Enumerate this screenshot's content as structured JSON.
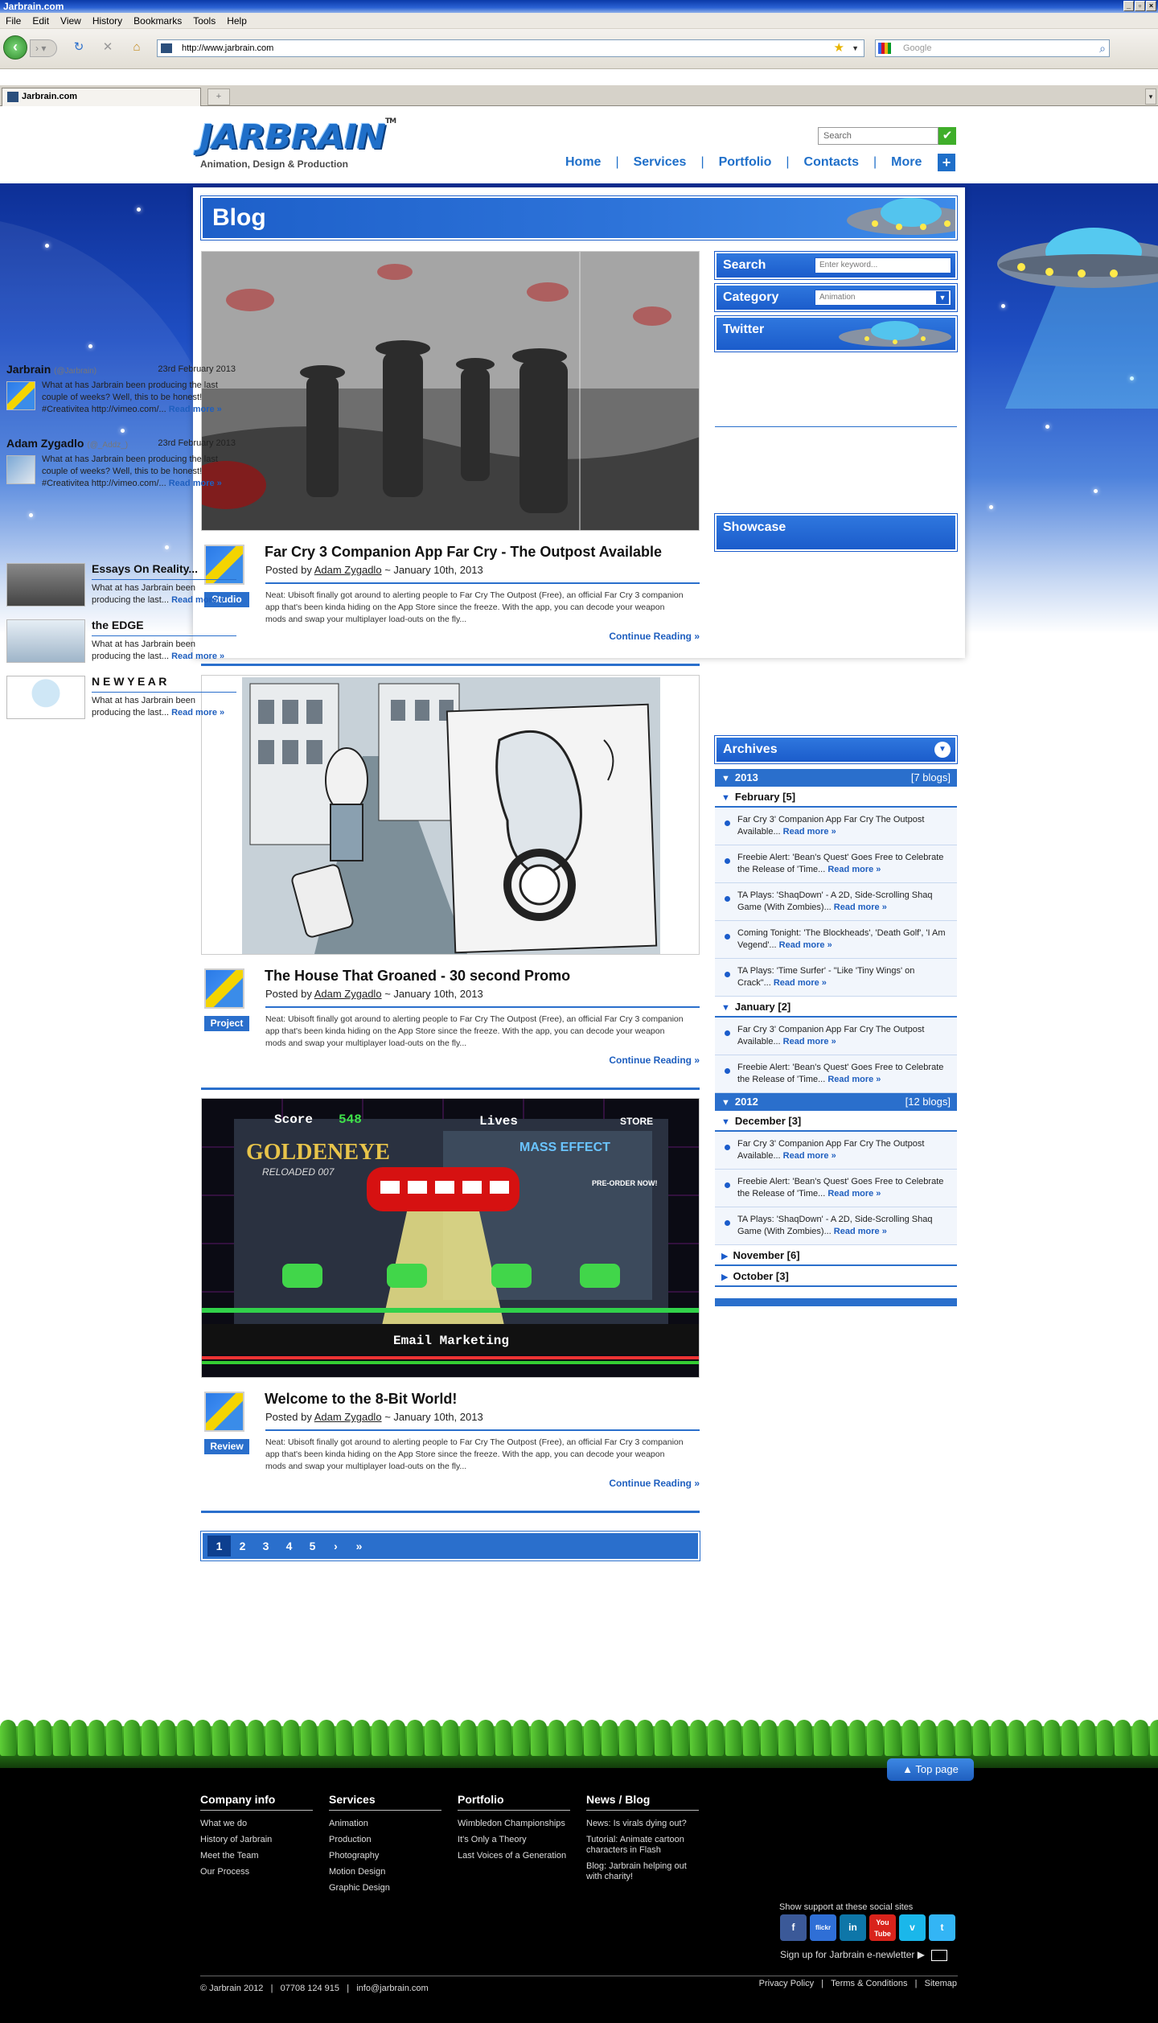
{
  "window": {
    "title": "Jarbrain.com"
  },
  "menu": [
    "File",
    "Edit",
    "View",
    "History",
    "Bookmarks",
    "Tools",
    "Help"
  ],
  "browser": {
    "url": "http://www.jarbrain.com",
    "search_placeholder": "Google",
    "tab_title": "Jarbrain.com"
  },
  "site": {
    "logo": "JARBRAIN",
    "tm": "TM",
    "tagline": "Animation, Design & Production",
    "search_placeholder": "Search",
    "nav": [
      "Home",
      "Services",
      "Portfolio",
      "Contacts",
      "More"
    ],
    "more_icon": "+",
    "page_title": "Blog"
  },
  "posts": [
    {
      "title": "Far Cry 3 Companion App Far Cry - The Outpost Available",
      "posted_by": "Posted by",
      "author": "Adam Zygadlo",
      "date": "~ January 10th, 2013",
      "tag": "Studio",
      "excerpt": "Neat: Ubisoft finally got around to alerting people to Far Cry The Outpost (Free), an official Far Cry 3 companion app that's been kinda hiding on the App Store since the freeze. With the app, you can decode your weapon mods and swap your multiplayer load-outs on the fly...",
      "continue": "Continue Reading »"
    },
    {
      "title": "The House That Groaned - 30 second Promo",
      "posted_by": "Posted by",
      "author": "Adam Zygadlo",
      "date": "~ January 10th, 2013",
      "tag": "Project",
      "excerpt": "Neat: Ubisoft finally got around to alerting people to Far Cry The Outpost (Free), an official Far Cry 3 companion app that's been kinda hiding on the App Store since the freeze. With the app, you can decode your weapon mods and swap your multiplayer load-outs on the fly...",
      "continue": "Continue Reading »"
    },
    {
      "title": "Welcome to the 8-Bit World!",
      "posted_by": "Posted by",
      "author": "Adam Zygadlo",
      "date": "~ January 10th, 2013",
      "tag": "Review",
      "excerpt": "Neat: Ubisoft finally got around to alerting people to Far Cry The Outpost (Free), an official Far Cry 3 companion app that's been kinda hiding on the App Store since the freeze. With the app, you can decode your weapon mods and swap your multiplayer load-outs on the fly...",
      "continue": "Continue Reading »"
    }
  ],
  "game_image": {
    "score_label": "Score",
    "score": "548",
    "lives_label": "Lives",
    "banner": "Email Marketing",
    "game_title": "GOLDENEYE",
    "game_sub": "RELOADED 007",
    "mass": "MASS EFFECT",
    "store": "STORE",
    "preorder": "PRE-ORDER NOW!"
  },
  "pagination": [
    "1",
    "2",
    "3",
    "4",
    "5",
    "›",
    "»"
  ],
  "sidebar": {
    "search_label": "Search",
    "search_placeholder": "Enter keyword...",
    "category_label": "Category",
    "category_value": "Animation",
    "twitter_label": "Twitter",
    "tweets": [
      {
        "name": "Jarbrain",
        "handle": "(@Jarbrain)",
        "date": "23rd February 2013",
        "text": "What at has Jarbrain been producing the last couple of weeks? Well, this to be honest! #Creativitea http://vimeo.com/...",
        "more": "Read more »"
      },
      {
        "name": "Adam Zygadlo",
        "handle": "(@_Addz_)",
        "date": "23rd February 2013",
        "text": "What at has Jarbrain been producing the last couple of weeks? Well, this to be honest! #Creativitea http://vimeo.com/...",
        "more": "Read more »"
      }
    ],
    "showcase_label": "Showcase",
    "showcase": [
      {
        "title": "Essays On Reality...",
        "text": "What at has Jarbrain been producing the last...",
        "more": "Read more »"
      },
      {
        "title": "the EDGE",
        "text": "What at has Jarbrain been producing the last...",
        "more": "Read more »"
      },
      {
        "title": "N E W Y E A R",
        "text": "What at has Jarbrain been producing the last...",
        "more": "Read more »"
      }
    ],
    "archives_label": "Archives",
    "years": [
      {
        "year": "2013",
        "count": "[7 blogs]",
        "months": [
          {
            "month": "February [5]",
            "items": [
              {
                "text": "Far Cry 3' Companion App Far Cry The Outpost Available...",
                "more": "Read more »"
              },
              {
                "text": "Freebie Alert: 'Bean's Quest' Goes Free to Celebrate the Release of 'Time...",
                "more": "Read more »"
              },
              {
                "text": "TA Plays: 'ShaqDown' - A 2D, Side-Scrolling Shaq Game (With Zombies)...",
                "more": "Read more »"
              },
              {
                "text": "Coming Tonight: 'The Blockheads', 'Death Golf', 'I Am Vegend'...",
                "more": "Read more »"
              },
              {
                "text": "TA Plays: 'Time Surfer' - \"Like 'Tiny Wings' on Crack\"...",
                "more": "Read more »"
              }
            ]
          },
          {
            "month": "January [2]",
            "items": [
              {
                "text": "Far Cry 3' Companion App Far Cry The Outpost Available...",
                "more": "Read more »"
              },
              {
                "text": "Freebie Alert: 'Bean's Quest' Goes Free to Celebrate the Release of 'Time...",
                "more": "Read more »"
              }
            ]
          }
        ]
      },
      {
        "year": "2012",
        "count": "[12 blogs]",
        "months": [
          {
            "month": "December [3]",
            "items": [
              {
                "text": "Far Cry 3' Companion App Far Cry The Outpost Available...",
                "more": "Read more »"
              },
              {
                "text": "Freebie Alert: 'Bean's Quest' Goes Free to Celebrate the Release of 'Time...",
                "more": "Read more »"
              },
              {
                "text": "TA Plays: 'ShaqDown' - A 2D, Side-Scrolling Shaq Game (With Zombies)...",
                "more": "Read more »"
              }
            ]
          },
          {
            "month": "November [6]",
            "items": []
          },
          {
            "month": "October [3]",
            "items": []
          }
        ]
      }
    ]
  },
  "footer": {
    "top_page": "▲ Top page",
    "columns": [
      {
        "title": "Company info",
        "links": [
          "What we do",
          "History of Jarbrain",
          "Meet the Team",
          "Our Process"
        ]
      },
      {
        "title": "Services",
        "links": [
          "Animation",
          "Production",
          "Photography",
          "Motion Design",
          "Graphic Design"
        ]
      },
      {
        "title": "Portfolio",
        "links": [
          "Wimbledon Championships",
          "It's Only a Theory",
          "Last Voices of a Generation"
        ]
      },
      {
        "title": "News / Blog",
        "links": [
          "News: Is virals dying out?",
          "Tutorial: Animate cartoon characters in Flash",
          "Blog: Jarbrain helping out with charity!"
        ]
      }
    ],
    "social_label": "Show support at these social sites",
    "socials": [
      {
        "label": "f",
        "color": "#3b5998"
      },
      {
        "label": "flickr",
        "color": "#2f6fd6"
      },
      {
        "label": "in",
        "color": "#0e76a8"
      },
      {
        "label": "You Tube",
        "color": "#d9231b"
      },
      {
        "label": "v",
        "color": "#1ab7ea"
      },
      {
        "label": "t",
        "color": "#33b5f5"
      }
    ],
    "newsletter": "Sign up for Jarbrain e-newletter ▶",
    "copyright": "© Jarbrain 2012   |   07708 124 915   |   info@jarbrain.com",
    "links": "Privacy Policy   |   Terms & Conditions   |   Sitemap"
  }
}
